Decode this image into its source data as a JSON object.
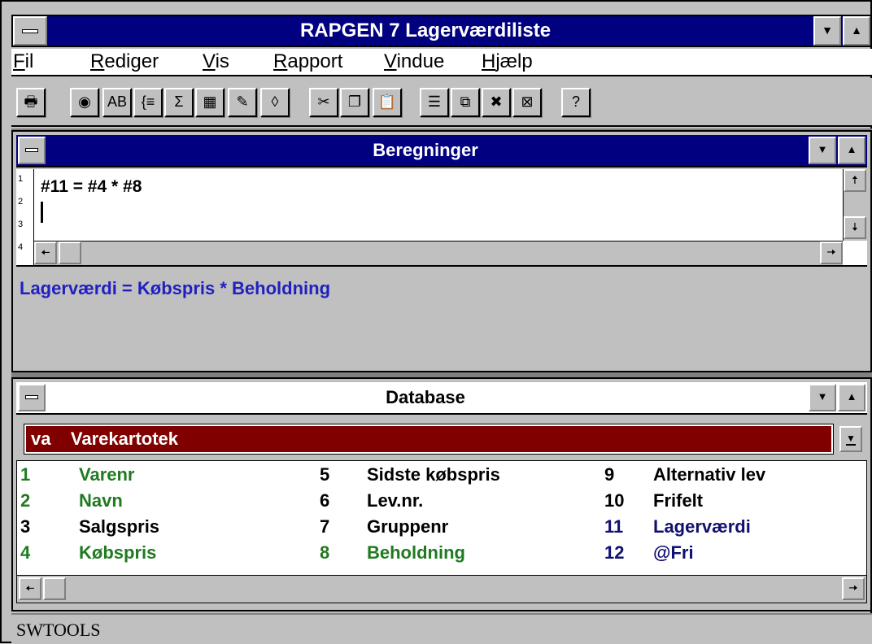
{
  "window": {
    "title": "RAPGEN 7 Lagerværdiliste",
    "down_arrow": "▼",
    "up_arrow": "▲"
  },
  "menu": [
    {
      "label": "Fil",
      "mnemonic_index": 0
    },
    {
      "label": "Rediger",
      "mnemonic_index": 0
    },
    {
      "label": "Vis",
      "mnemonic_index": 0
    },
    {
      "label": "Rapport",
      "mnemonic_index": 0
    },
    {
      "label": "Vindue",
      "mnemonic_index": 0
    },
    {
      "label": "Hjælp",
      "mnemonic_index": 0
    }
  ],
  "toolbar": {
    "buttons": [
      {
        "icon": "print-icon",
        "glyph": "🖶"
      },
      {
        "icon": "field-icon",
        "glyph": "◉"
      },
      {
        "icon": "text-icon",
        "glyph": "AB"
      },
      {
        "icon": "condition-icon",
        "glyph": "{≡"
      },
      {
        "icon": "sum-icon",
        "glyph": "Σ"
      },
      {
        "icon": "calculator-icon",
        "glyph": "▦"
      },
      {
        "icon": "edit-chart-icon",
        "glyph": "✎"
      },
      {
        "icon": "eraser-icon",
        "glyph": "◊"
      },
      {
        "icon": "cut-icon",
        "glyph": "✂"
      },
      {
        "icon": "copy-icon",
        "glyph": "❐"
      },
      {
        "icon": "paste-icon",
        "glyph": "📋"
      },
      {
        "icon": "layout-icon",
        "glyph": "☰"
      },
      {
        "icon": "windows-icon",
        "glyph": "⧉"
      },
      {
        "icon": "delete-x-icon",
        "glyph": "✖"
      },
      {
        "icon": "close-box-icon",
        "glyph": "⊠"
      },
      {
        "icon": "help-icon",
        "glyph": "?"
      }
    ]
  },
  "beregninger": {
    "title": "Beregninger",
    "line_numbers": [
      "1",
      "2",
      "3",
      "4"
    ],
    "lines": [
      "#11 = #4 * #8",
      ""
    ],
    "description": "Lagerværdi = Købspris * Beholdning",
    "description_color": "#2020c0"
  },
  "database": {
    "title": "Database",
    "selected_table": "va    Varekartotek",
    "dropdown_arrow": "▼",
    "fields": [
      {
        "num": "1",
        "name": "Varenr",
        "color": "#207a20"
      },
      {
        "num": "2",
        "name": "Navn",
        "color": "#207a20"
      },
      {
        "num": "3",
        "name": "Salgspris",
        "color": "#000000"
      },
      {
        "num": "4",
        "name": "Købspris",
        "color": "#207a20"
      },
      {
        "num": "5",
        "name": "Sidste købspris",
        "color": "#000000"
      },
      {
        "num": "6",
        "name": "Lev.nr.",
        "color": "#000000"
      },
      {
        "num": "7",
        "name": "Gruppenr",
        "color": "#000000"
      },
      {
        "num": "8",
        "name": "Beholdning",
        "color": "#207a20"
      },
      {
        "num": "9",
        "name": "Alternativ lev",
        "color": "#000000"
      },
      {
        "num": "10",
        "name": "Frifelt",
        "color": "#000000"
      },
      {
        "num": "11",
        "name": "Lagerværdi",
        "color": "#101070"
      },
      {
        "num": "12",
        "name": "@Fri",
        "color": "#101070"
      }
    ]
  },
  "status": {
    "text": "SWTOOLS"
  },
  "colors": {
    "title_bar": "#000080",
    "table_bar": "#800000",
    "face": "#c0c0c0"
  }
}
